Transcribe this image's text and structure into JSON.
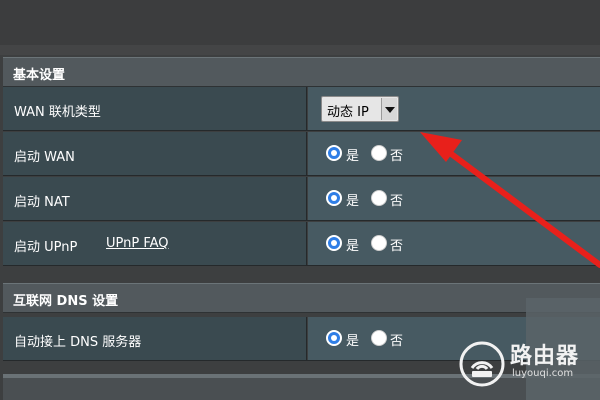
{
  "sections": [
    {
      "title": "基本设置",
      "rows": [
        {
          "label": "WAN 联机类型",
          "control": "select",
          "value": "动态 IP"
        },
        {
          "label": "启动 WAN",
          "control": "radio",
          "yes": "是",
          "no": "否",
          "selected": "yes"
        },
        {
          "label": "启动 NAT",
          "control": "radio",
          "yes": "是",
          "no": "否",
          "selected": "yes"
        },
        {
          "label": "启动 UPnP",
          "link": "UPnP FAQ",
          "control": "radio",
          "yes": "是",
          "no": "否",
          "selected": "yes"
        }
      ]
    },
    {
      "title": "互联网 DNS 设置",
      "rows": [
        {
          "label": "自动接上 DNS 服务器",
          "control": "radio",
          "yes": "是",
          "no": "否",
          "selected": "yes"
        }
      ]
    }
  ],
  "watermark": {
    "name": "路由器",
    "url": "luyouqi.com"
  },
  "colors": {
    "annotation_arrow": "#e8201b",
    "radio_selected": "#2f7ee6",
    "header_bg": "#52595d",
    "label_bg": "#3a4a50",
    "value_bg": "#475a62"
  }
}
